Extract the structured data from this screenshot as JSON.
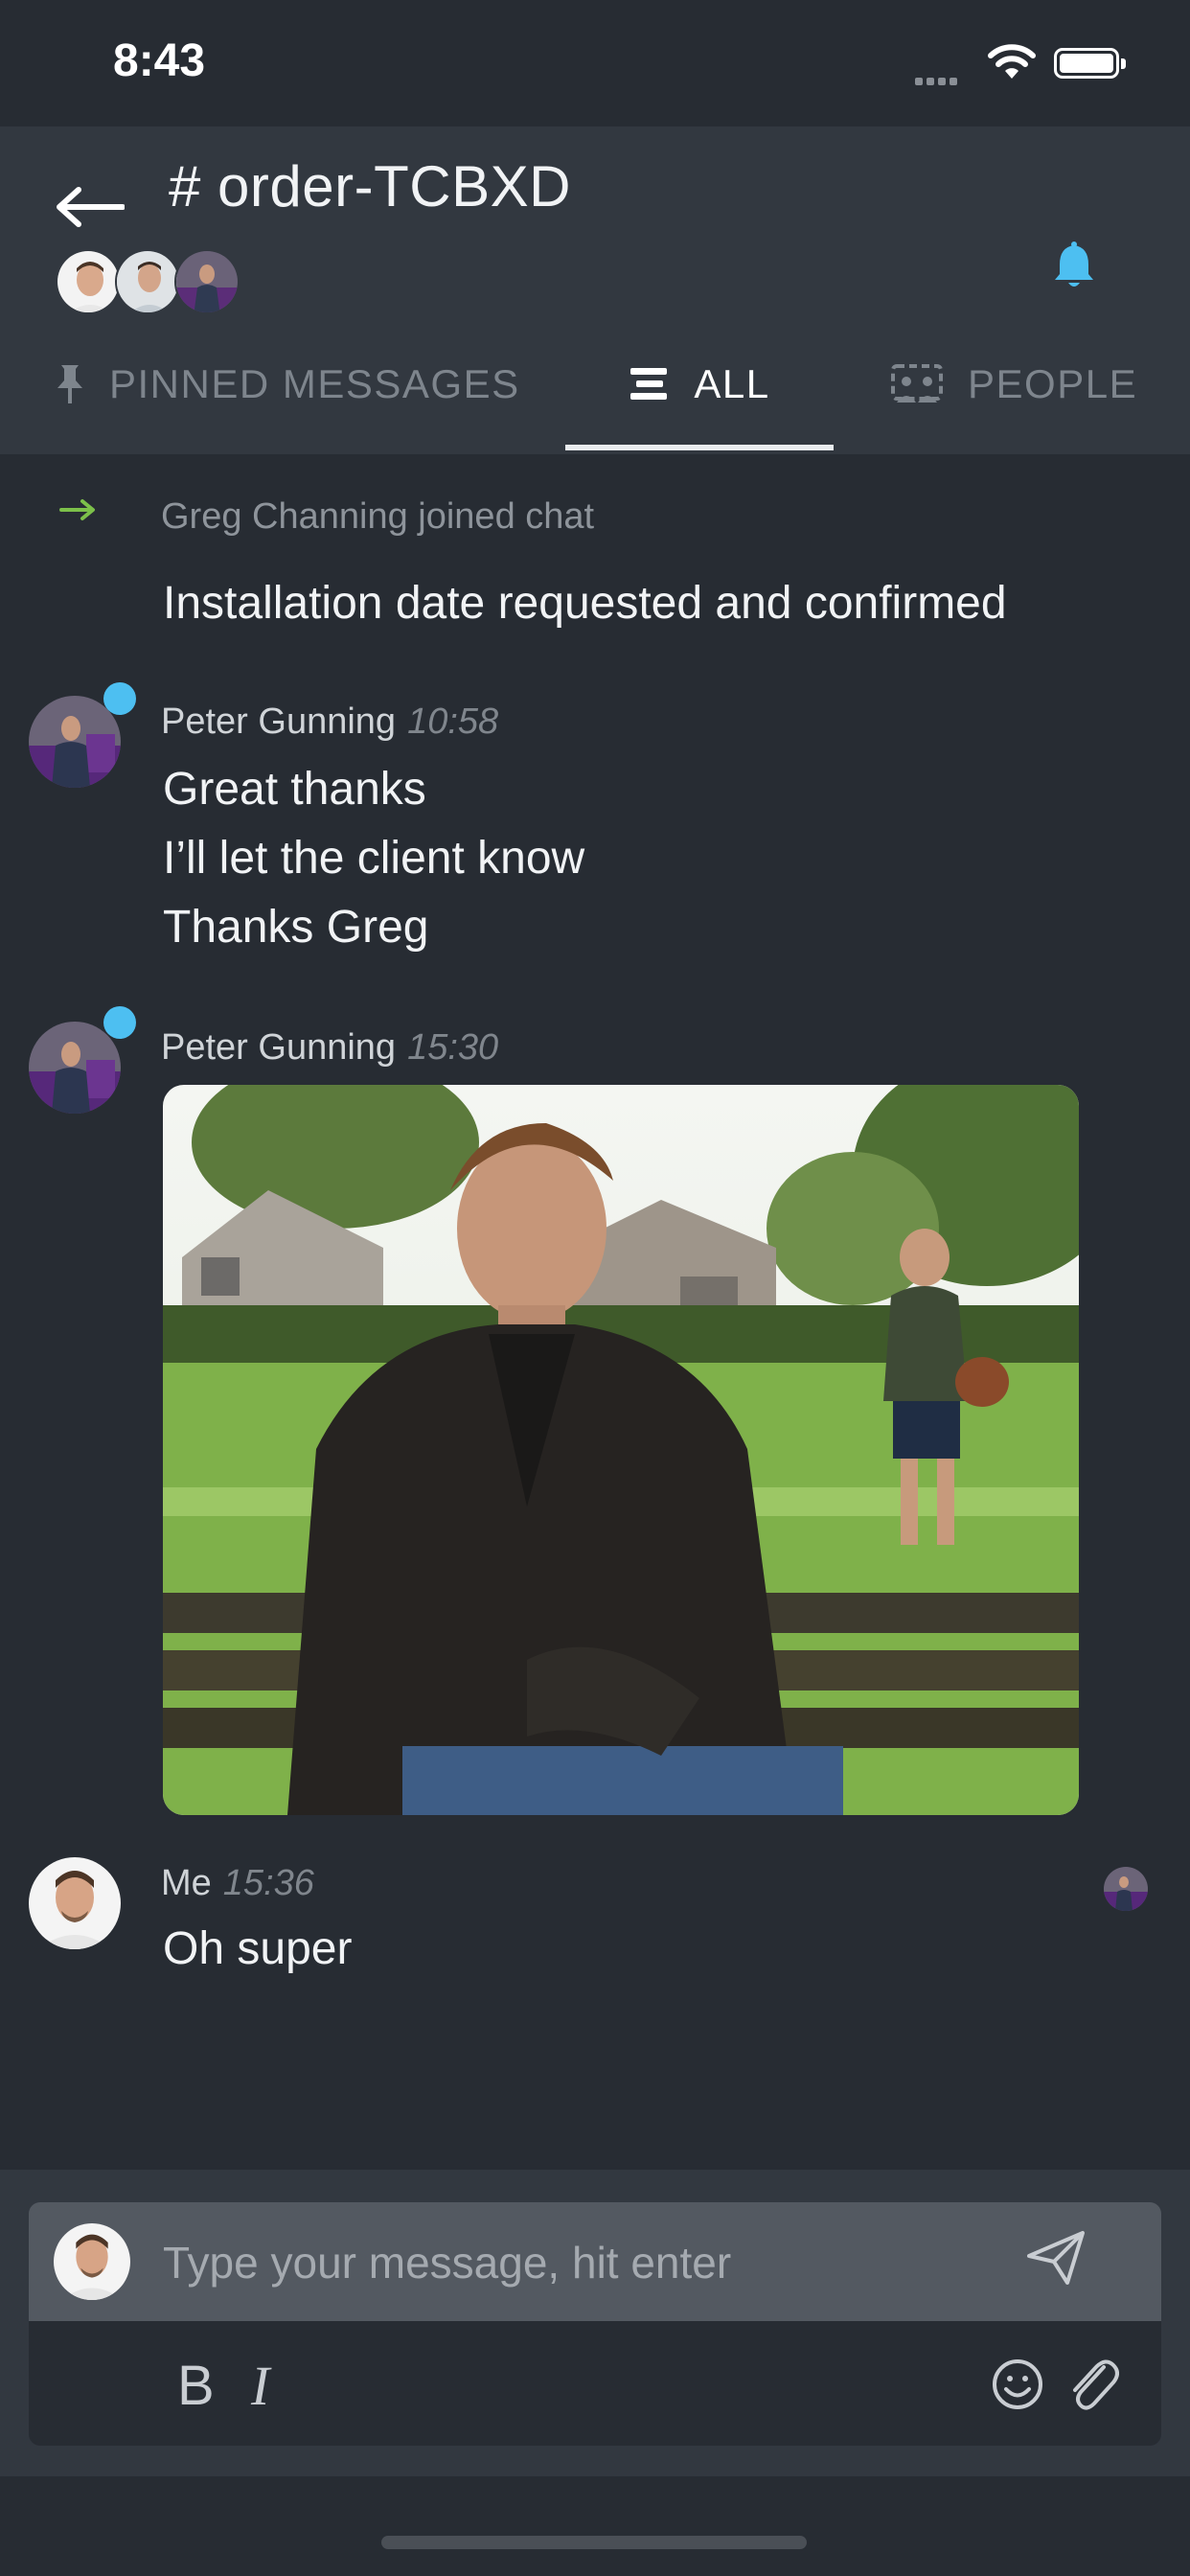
{
  "status_bar": {
    "time": "8:43"
  },
  "header": {
    "channel_title": "# order-TCBXD",
    "member_avatar_icons": [
      "avatar-me-icon",
      "avatar-greg-icon",
      "avatar-peter-icon"
    ]
  },
  "tabs": [
    {
      "label": "PINNED MESSAGES",
      "icon": "pin-icon",
      "active": false
    },
    {
      "label": "ALL",
      "icon": "list-icon",
      "active": true
    },
    {
      "label": "PEOPLE",
      "icon": "people-icon",
      "active": false
    }
  ],
  "messages": {
    "system": {
      "text": "Greg Channing joined chat"
    },
    "greg_line": "Installation date requested and confirmed",
    "peter1": {
      "author": "Peter Gunning",
      "time": "10:58",
      "lines": [
        "Great thanks",
        "I’ll let the client know",
        "Thanks Greg"
      ]
    },
    "peter2": {
      "author": "Peter Gunning",
      "time": "15:30",
      "image": "man-on-park-bench-photo"
    },
    "me": {
      "author": "Me",
      "time": "15:36",
      "text": "Oh super"
    }
  },
  "composer": {
    "placeholder": "Type your message, hit enter",
    "bold_label": "B",
    "italic_label": "I"
  },
  "colors": {
    "accent": "#4dbff1",
    "background": "#272c33",
    "header": "#323840",
    "join_arrow": "#7cc04a"
  }
}
